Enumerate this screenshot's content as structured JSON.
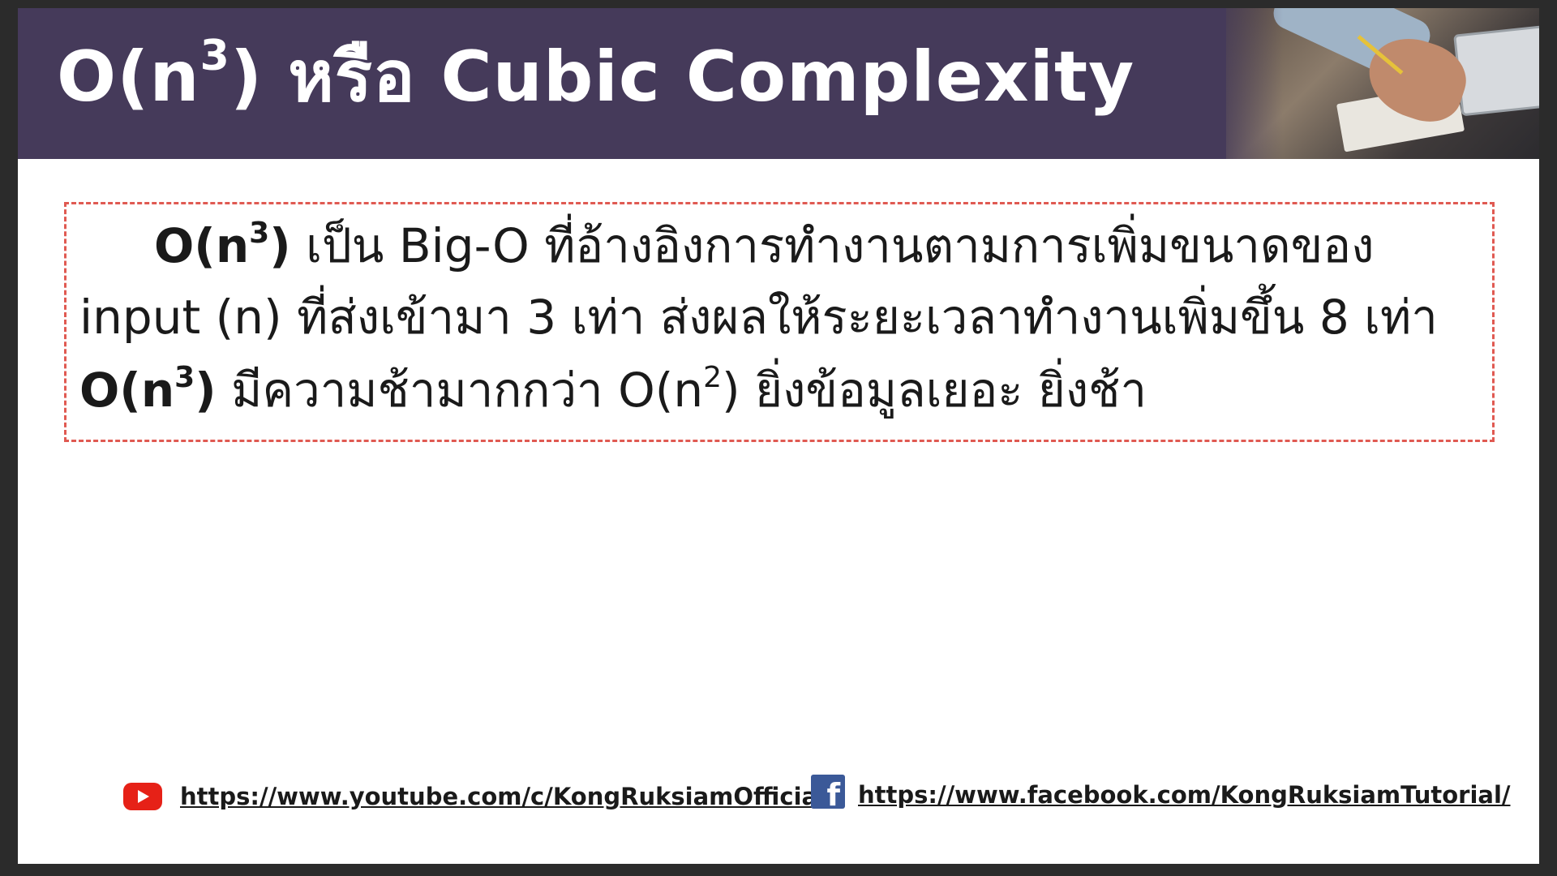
{
  "header": {
    "title_prefix": "O(n",
    "title_sup": "3",
    "title_suffix": ") หรือ Cubic Complexity"
  },
  "content": {
    "line1": {
      "bold_prefix": "O(n",
      "bold_sup": "3",
      "bold_suffix": ")",
      "text": " เป็น Big-O ที่อ้างอิงการทำงานตามการเพิ่มขนาดของ"
    },
    "line2": {
      "text": "input (n) ที่ส่งเข้ามา 3 เท่า ส่งผลให้ระยะเวลาทำงานเพิ่มขึ้น 8 เท่า"
    },
    "line3": {
      "bold_prefix": "O(n",
      "bold_sup": "3",
      "bold_suffix": ")",
      "text_a": " มีความช้ามากกว่า O(n",
      "sup2": "2",
      "text_b": ") ยิ่งข้อมูลเยอะ ยิ่งช้า"
    }
  },
  "footer": {
    "youtube_url": "https://www.youtube.com/c/KongRuksiamOfficial/",
    "facebook_url": "https://www.facebook.com/KongRuksiamTutorial/",
    "youtube_icon": "youtube-icon",
    "facebook_icon": "facebook-icon"
  },
  "colors": {
    "header_bg": "#453a5a",
    "border_dashed": "#e05a52",
    "youtube_red": "#e62117",
    "facebook_blue": "#3b5998"
  }
}
